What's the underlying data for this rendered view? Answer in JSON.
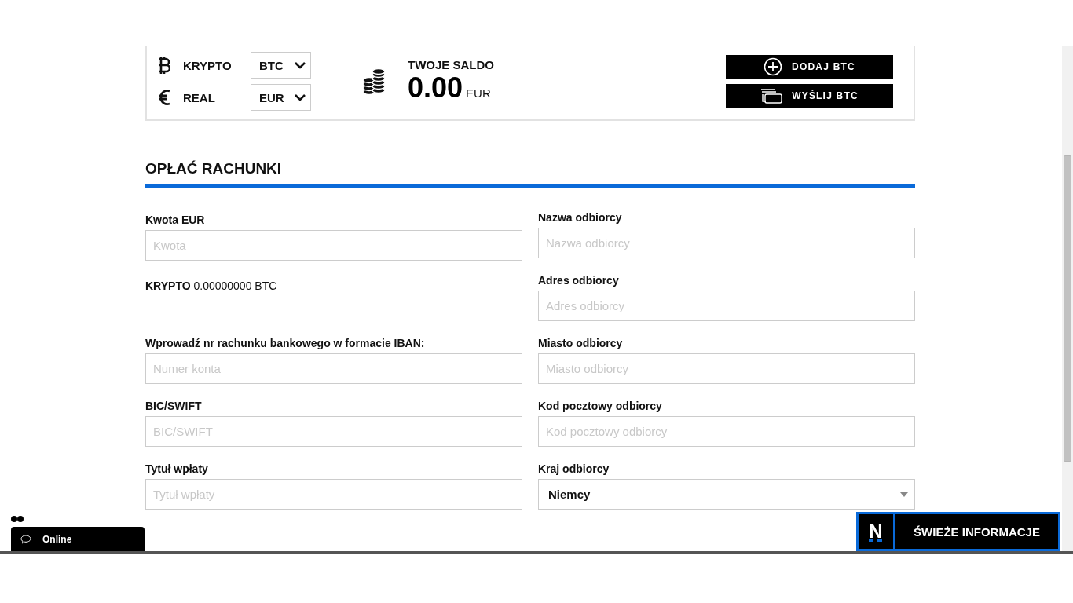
{
  "currencies": [
    {
      "kind": "crypto",
      "label": "KRYPTO",
      "value": "BTC"
    },
    {
      "kind": "fiat",
      "label": "REAL",
      "value": "EUR"
    }
  ],
  "balance": {
    "label": "TWOJE SALDO",
    "amount": "0.00",
    "currency": "EUR"
  },
  "actions": [
    {
      "kind": "add",
      "label": "DODAJ BTC"
    },
    {
      "kind": "send",
      "label": "WYŚLIJ BTC"
    }
  ],
  "section_title": "OPŁAĆ RACHUNKI",
  "left_fields": [
    {
      "kind": "input",
      "label": "Kwota EUR",
      "placeholder": "Kwota"
    },
    {
      "kind": "info",
      "label": "KRYPTO",
      "value": "0.00000000 BTC"
    },
    {
      "kind": "input",
      "label": "Wprowadź nr rachunku bankowego w formacie IBAN:",
      "placeholder": "Numer konta"
    },
    {
      "kind": "input",
      "label": "BIC/SWIFT",
      "placeholder": "BIC/SWIFT"
    },
    {
      "kind": "input",
      "label": "Tytuł wpłaty",
      "placeholder": "Tytuł wpłaty"
    }
  ],
  "right_fields": [
    {
      "kind": "input",
      "label": "Nazwa odbiorcy",
      "placeholder": "Nazwa odbiorcy"
    },
    {
      "kind": "input",
      "label": "Adres odbiorcy",
      "placeholder": "Adres odbiorcy"
    },
    {
      "kind": "input",
      "label": "Miasto odbiorcy",
      "placeholder": "Miasto odbiorcy"
    },
    {
      "kind": "input",
      "label": "Kod pocztowy odbiorcy",
      "placeholder": "Kod pocztowy odbiorcy"
    },
    {
      "kind": "select",
      "label": "Kraj odbiorcy",
      "value": "Niemcy"
    }
  ],
  "chat": {
    "status": "Online"
  },
  "news": {
    "logo": "N",
    "label": "ŚWIEŻE INFORMACJE"
  }
}
